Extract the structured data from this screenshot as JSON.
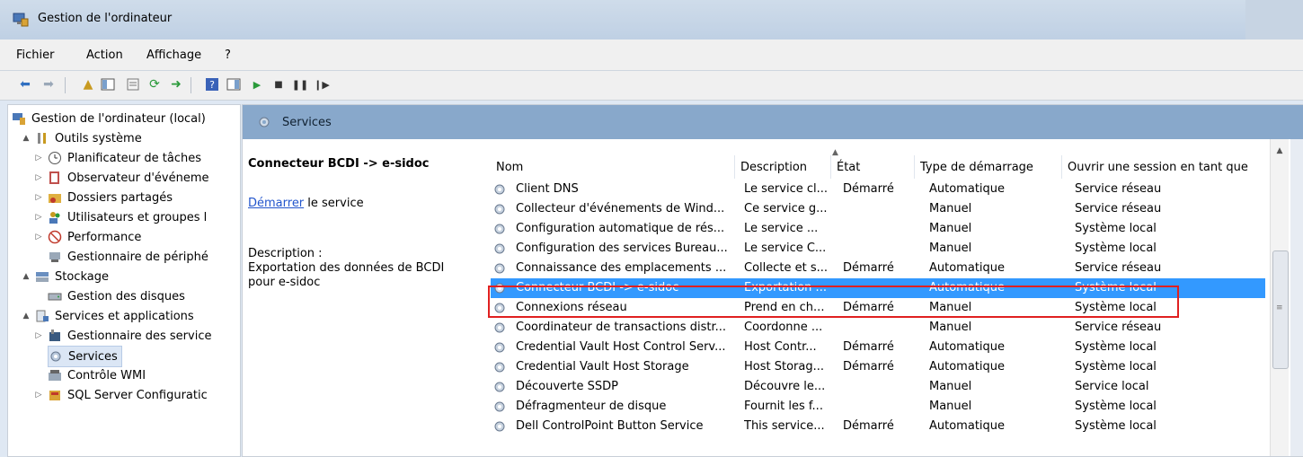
{
  "window": {
    "title": "Gestion de l'ordinateur"
  },
  "menu": [
    {
      "label": "Fichier"
    },
    {
      "label": "Action"
    },
    {
      "label": "Affichage"
    },
    {
      "label": "?"
    }
  ],
  "tree": [
    {
      "label": "Gestion de l'ordinateur (local)",
      "icon": "computer-icon",
      "indent": 0,
      "arrow": ""
    },
    {
      "label": "Outils système",
      "icon": "tools-icon",
      "indent": 1,
      "arrow": "▲"
    },
    {
      "label": "Planificateur de tâches",
      "icon": "clock-icon",
      "indent": 2,
      "arrow": "▷"
    },
    {
      "label": "Observateur d'événeme",
      "icon": "event-viewer-icon",
      "indent": 2,
      "arrow": "▷"
    },
    {
      "label": "Dossiers partagés",
      "icon": "shared-folder-icon",
      "indent": 2,
      "arrow": "▷"
    },
    {
      "label": "Utilisateurs et groupes l",
      "icon": "users-icon",
      "indent": 2,
      "arrow": "▷"
    },
    {
      "label": "Performance",
      "icon": "performance-icon",
      "indent": 2,
      "arrow": "▷"
    },
    {
      "label": "Gestionnaire de périphé",
      "icon": "device-manager-icon",
      "indent": 2,
      "arrow": ""
    },
    {
      "label": "Stockage",
      "icon": "storage-icon",
      "indent": 1,
      "arrow": "▲"
    },
    {
      "label": "Gestion des disques",
      "icon": "disk-icon",
      "indent": 2,
      "arrow": ""
    },
    {
      "label": "Services et applications",
      "icon": "services-apps-icon",
      "indent": 1,
      "arrow": "▲"
    },
    {
      "label": "Gestionnaire des service",
      "icon": "service-manager-icon",
      "indent": 2,
      "arrow": "▷"
    },
    {
      "label": "Services",
      "icon": "services-icon",
      "indent": 2,
      "arrow": ""
    },
    {
      "label": "Contrôle WMI",
      "icon": "wmi-icon",
      "indent": 2,
      "arrow": ""
    },
    {
      "label": "SQL Server Configuratic",
      "icon": "sql-server-icon",
      "indent": 2,
      "arrow": "▷"
    }
  ],
  "services_header": {
    "title": "Services"
  },
  "detail": {
    "service_name": "Connecteur BCDI -> e-sidoc",
    "start_link": "Démarrer",
    "start_suffix": " le service",
    "description_label": "Description :",
    "description_text": "Exportation des données de BCDI pour e-sidoc"
  },
  "columns": [
    "Nom",
    "Description",
    "État",
    "Type de démarrage",
    "Ouvrir une session en tant que"
  ],
  "rows": [
    [
      "Client DNS",
      "Le service cl...",
      "Démarré",
      "Automatique",
      "Service réseau"
    ],
    [
      "Collecteur d'événements de Wind...",
      "Ce service g...",
      "",
      "Manuel",
      "Service réseau"
    ],
    [
      "Configuration automatique de rés...",
      "Le service ...",
      "",
      "Manuel",
      "Système local"
    ],
    [
      "Configuration des services Bureau...",
      "Le service C...",
      "",
      "Manuel",
      "Système local"
    ],
    [
      "Connaissance des emplacements ...",
      "Collecte et s...",
      "Démarré",
      "Automatique",
      "Service réseau"
    ],
    [
      "Connecteur BCDI -> e-sidoc",
      "Exportation ...",
      "",
      "Automatique",
      "Système local"
    ],
    [
      "Connexions réseau",
      "Prend en ch...",
      "Démarré",
      "Manuel",
      "Système local"
    ],
    [
      "Coordinateur de transactions distr...",
      "Coordonne ...",
      "",
      "Manuel",
      "Service réseau"
    ],
    [
      "Credential Vault Host Control Serv...",
      "Host Contr...",
      "Démarré",
      "Automatique",
      "Système local"
    ],
    [
      "Credential Vault Host Storage",
      "Host Storag...",
      "Démarré",
      "Automatique",
      "Système local"
    ],
    [
      "Découverte SSDP",
      "Découvre le...",
      "",
      "Manuel",
      "Service local"
    ],
    [
      "Défragmenteur de disque",
      "Fournit les f...",
      "",
      "Manuel",
      "Système local"
    ],
    [
      "Dell ControlPoint Button Service",
      "This service...",
      "Démarré",
      "Automatique",
      "Système local"
    ]
  ],
  "selected_row": 5,
  "colors": {
    "selection": "#3399ff",
    "highlight_box": "#e02020",
    "header_band": "#88a8cb"
  }
}
